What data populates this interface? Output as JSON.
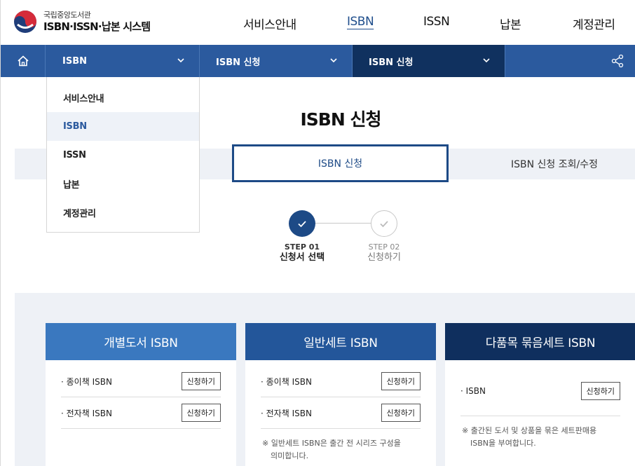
{
  "header": {
    "logo_org": "국립중앙도서관",
    "logo_title": "ISBN·ISSN·납본 시스템",
    "nav": [
      {
        "label": "서비스안내",
        "active": false
      },
      {
        "label": "ISBN",
        "active": true
      },
      {
        "label": "ISSN",
        "active": false
      },
      {
        "label": "납본",
        "active": false
      },
      {
        "label": "계정관리",
        "active": false
      }
    ]
  },
  "locbar": {
    "seg1": "ISBN",
    "seg2": "ISBN 신청",
    "seg3": "ISBN 신청"
  },
  "dropdown": {
    "items": [
      "서비스안내",
      "ISBN",
      "ISSN",
      "납본",
      "계정관리"
    ],
    "active_index": 1
  },
  "page": {
    "title": "ISBN 신청"
  },
  "tabs": {
    "active": "ISBN 신청",
    "inactive": "ISBN 신청 조회/수정"
  },
  "steps": [
    {
      "num": "STEP 01",
      "name": "신청서 선택",
      "done": true
    },
    {
      "num": "STEP 02",
      "name": "신청하기",
      "done": false
    }
  ],
  "cards": [
    {
      "title": "개별도서 ISBN",
      "color": "#3a78bf",
      "rows": [
        {
          "label": "· 종이책 ISBN",
          "button": "신청하기"
        },
        {
          "label": "· 전자책 ISBN",
          "button": "신청하기"
        }
      ]
    },
    {
      "title": "일반세트 ISBN",
      "color": "#23569a",
      "rows": [
        {
          "label": "· 종이책 ISBN",
          "button": "신청하기"
        },
        {
          "label": "· 전자책 ISBN",
          "button": "신청하기"
        }
      ],
      "note_line1": "※ 일반세트 ISBN은 출간 전 시리즈 구성을",
      "note_line2": "의미합니다."
    },
    {
      "title": "다품목 묶음세트 ISBN",
      "color": "#0f2f5e",
      "rows": [
        {
          "label": "· ISBN",
          "button": "신청하기"
        }
      ],
      "note_line1": "※ 출간된 도서 및 상품을 묶은 세트판매용",
      "note_line2": "ISBN을 부여합니다."
    }
  ],
  "colors": {
    "locbar": "#2b5a9e",
    "locbar_dark": "#10315f",
    "accent": "#1d4a86",
    "band": "#eef1f6"
  }
}
